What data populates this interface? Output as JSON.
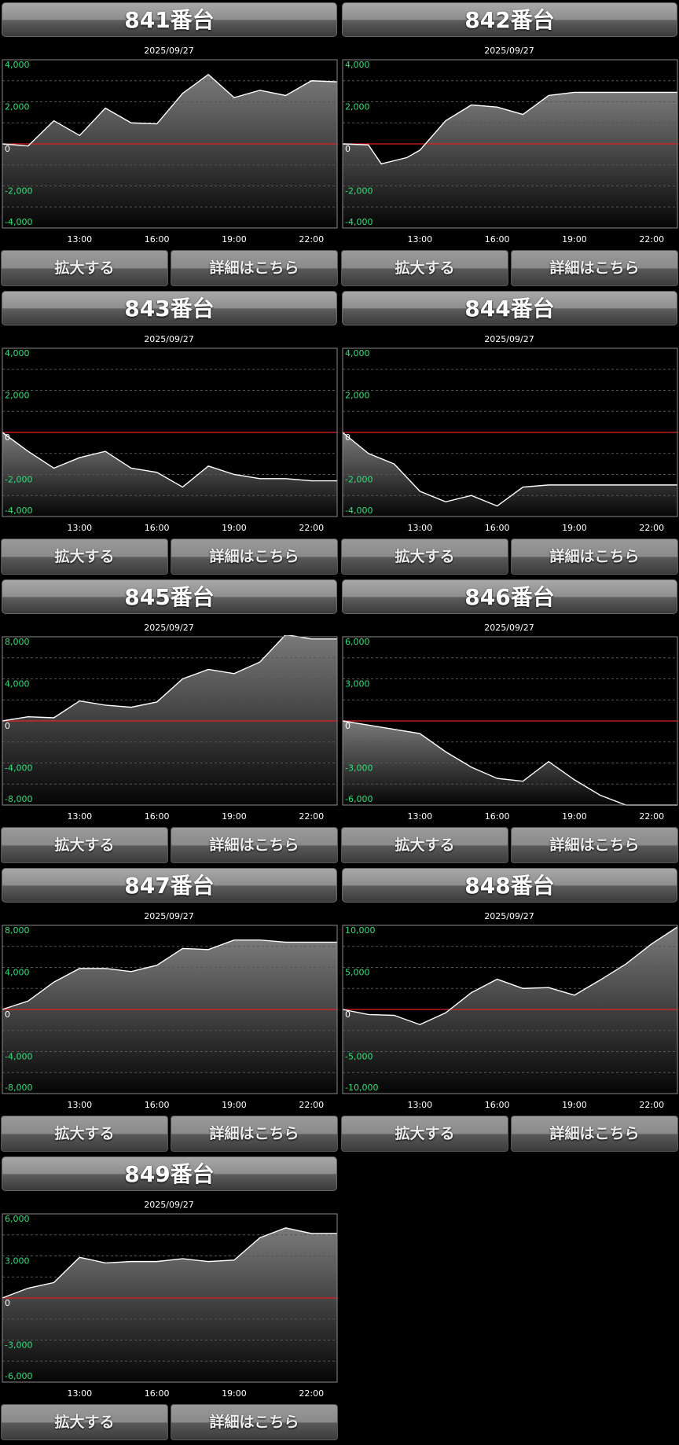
{
  "zoom_label": "拡大する",
  "detail_label": "詳細はこちら",
  "colors": {
    "grid_label": "#2fe07a",
    "zero_line": "#e02020",
    "line": "#ffffff",
    "frame": "#8a8a8a"
  },
  "chart_data": [
    {
      "type": "area",
      "title": "841番台",
      "date": "2025/09/27",
      "x": [
        "11:00",
        "12:00",
        "13:00",
        "14:00",
        "15:00",
        "16:00",
        "17:00",
        "18:00",
        "19:00",
        "20:00",
        "21:00",
        "22:00",
        "23:00"
      ],
      "x_ticks": [
        "13:00",
        "16:00",
        "19:00",
        "22:00"
      ],
      "values": [
        0,
        -100,
        1100,
        400,
        1700,
        1000,
        950,
        2400,
        3300,
        2200,
        2550,
        2300,
        3000,
        2950
      ],
      "value_times": [
        10.0,
        11.0,
        12.0,
        13.0,
        14.0,
        15.0,
        16.0,
        17.0,
        18.0,
        19.0,
        20.0,
        21.0,
        22.0,
        23.0
      ],
      "ylim": [
        -4000,
        4000
      ],
      "y_ticks": [
        "4,000",
        "2,000",
        "0",
        "-2,000",
        "-4,000"
      ]
    },
    {
      "type": "area",
      "title": "842番台",
      "date": "2025/09/27",
      "x_ticks": [
        "13:00",
        "16:00",
        "19:00",
        "22:00"
      ],
      "values": [
        0,
        -50,
        -950,
        -650,
        -300,
        1100,
        1850,
        1750,
        1400,
        2300,
        2450,
        2450,
        2450,
        2450
      ],
      "value_times": [
        10.0,
        11.0,
        11.5,
        12.5,
        13.0,
        14.0,
        15.0,
        16.0,
        17.0,
        18.0,
        19.0,
        20.0,
        22.0,
        23.0
      ],
      "ylim": [
        -4000,
        4000
      ],
      "y_ticks": [
        "4,000",
        "2,000",
        "0",
        "-2,000",
        "-4,000"
      ]
    },
    {
      "type": "area",
      "title": "843番台",
      "date": "2025/09/27",
      "x_ticks": [
        "13:00",
        "16:00",
        "19:00",
        "22:00"
      ],
      "values": [
        0,
        -900,
        -1700,
        -1200,
        -900,
        -1700,
        -1900,
        -2600,
        -1600,
        -2000,
        -2200,
        -2200,
        -2300,
        -2300
      ],
      "value_times": [
        10.0,
        11.0,
        12.0,
        13.0,
        14.0,
        15.0,
        16.0,
        17.0,
        18.0,
        19.0,
        20.0,
        21.0,
        22.0,
        23.0
      ],
      "ylim": [
        -4000,
        4000
      ],
      "y_ticks": [
        "4,000",
        "2,000",
        "0",
        "-2,000",
        "-4,000"
      ]
    },
    {
      "type": "area",
      "title": "844番台",
      "date": "2025/09/27",
      "x_ticks": [
        "13:00",
        "16:00",
        "19:00",
        "22:00"
      ],
      "values": [
        0,
        -1000,
        -1500,
        -2800,
        -3300,
        -3000,
        -3500,
        -2600,
        -2500,
        -2500,
        -2500,
        -2500,
        -2500,
        -2500
      ],
      "value_times": [
        10.0,
        11.0,
        12.0,
        13.0,
        14.0,
        15.0,
        16.0,
        17.0,
        18.0,
        19.0,
        20.0,
        21.0,
        22.0,
        23.0
      ],
      "ylim": [
        -4000,
        4000
      ],
      "y_ticks": [
        "4,000",
        "2,000",
        "0",
        "-2,000",
        "-4,000"
      ]
    },
    {
      "type": "area",
      "title": "845番台",
      "date": "2025/09/27",
      "x_ticks": [
        "13:00",
        "16:00",
        "19:00",
        "22:00"
      ],
      "values": [
        0,
        400,
        300,
        1900,
        1500,
        1300,
        1800,
        4000,
        4900,
        4500,
        5600,
        8200,
        7800,
        7800
      ],
      "value_times": [
        10.0,
        11.0,
        12.0,
        13.0,
        14.0,
        15.0,
        16.0,
        17.0,
        18.0,
        19.0,
        20.0,
        21.0,
        22.0,
        23.0
      ],
      "ylim": [
        -8000,
        8000
      ],
      "y_ticks": [
        "8,000",
        "4,000",
        "0",
        "-4,000",
        "-8,000"
      ]
    },
    {
      "type": "area",
      "title": "846番台",
      "date": "2025/09/27",
      "x_ticks": [
        "13:00",
        "16:00",
        "19:00",
        "22:00"
      ],
      "values": [
        0,
        -300,
        -600,
        -900,
        -2200,
        -3300,
        -4100,
        -4300,
        -2900,
        -4200,
        -5300,
        -6000,
        -6000,
        -6000
      ],
      "value_times": [
        10.0,
        11.0,
        12.0,
        13.0,
        14.0,
        15.0,
        16.0,
        17.0,
        18.0,
        19.0,
        20.0,
        21.0,
        22.0,
        23.0
      ],
      "ylim": [
        -6000,
        6000
      ],
      "y_ticks": [
        "6,000",
        "3,000",
        "0",
        "-3,000",
        "-6,000"
      ]
    },
    {
      "type": "area",
      "title": "847番台",
      "date": "2025/09/27",
      "x_ticks": [
        "13:00",
        "16:00",
        "19:00",
        "22:00"
      ],
      "values": [
        0,
        800,
        2600,
        3900,
        3900,
        3600,
        4200,
        5800,
        5700,
        6600,
        6600,
        6400,
        6400,
        6400
      ],
      "value_times": [
        10.0,
        11.0,
        12.0,
        13.0,
        14.0,
        15.0,
        16.0,
        17.0,
        18.0,
        19.0,
        20.0,
        21.0,
        22.0,
        23.0
      ],
      "ylim": [
        -8000,
        8000
      ],
      "y_ticks": [
        "8,000",
        "4,000",
        "0",
        "-4,000",
        "-8,000"
      ]
    },
    {
      "type": "area",
      "title": "848番台",
      "date": "2025/09/27",
      "x_ticks": [
        "13:00",
        "16:00",
        "19:00",
        "22:00"
      ],
      "values": [
        0,
        -600,
        -700,
        -1800,
        -400,
        2000,
        3600,
        2500,
        2600,
        1700,
        3500,
        5400,
        7800,
        9800
      ],
      "value_times": [
        10.0,
        11.0,
        12.0,
        13.0,
        14.0,
        15.0,
        16.0,
        17.0,
        18.0,
        19.0,
        20.0,
        21.0,
        22.0,
        23.0
      ],
      "ylim": [
        -10000,
        10000
      ],
      "y_ticks": [
        "10,000",
        "5,000",
        "0",
        "-5,000",
        "-10,000"
      ]
    },
    {
      "type": "area",
      "title": "849番台",
      "date": "2025/09/27",
      "x_ticks": [
        "13:00",
        "16:00",
        "19:00",
        "22:00"
      ],
      "values": [
        0,
        700,
        1100,
        2900,
        2500,
        2600,
        2600,
        2800,
        2600,
        2700,
        4300,
        5000,
        4600,
        4600
      ],
      "value_times": [
        10.0,
        11.0,
        12.0,
        13.0,
        14.0,
        15.0,
        16.0,
        17.0,
        18.0,
        19.0,
        20.0,
        21.0,
        22.0,
        23.0
      ],
      "ylim": [
        -6000,
        6000
      ],
      "y_ticks": [
        "6,000",
        "3,000",
        "0",
        "-3,000",
        "-6,000"
      ]
    }
  ]
}
